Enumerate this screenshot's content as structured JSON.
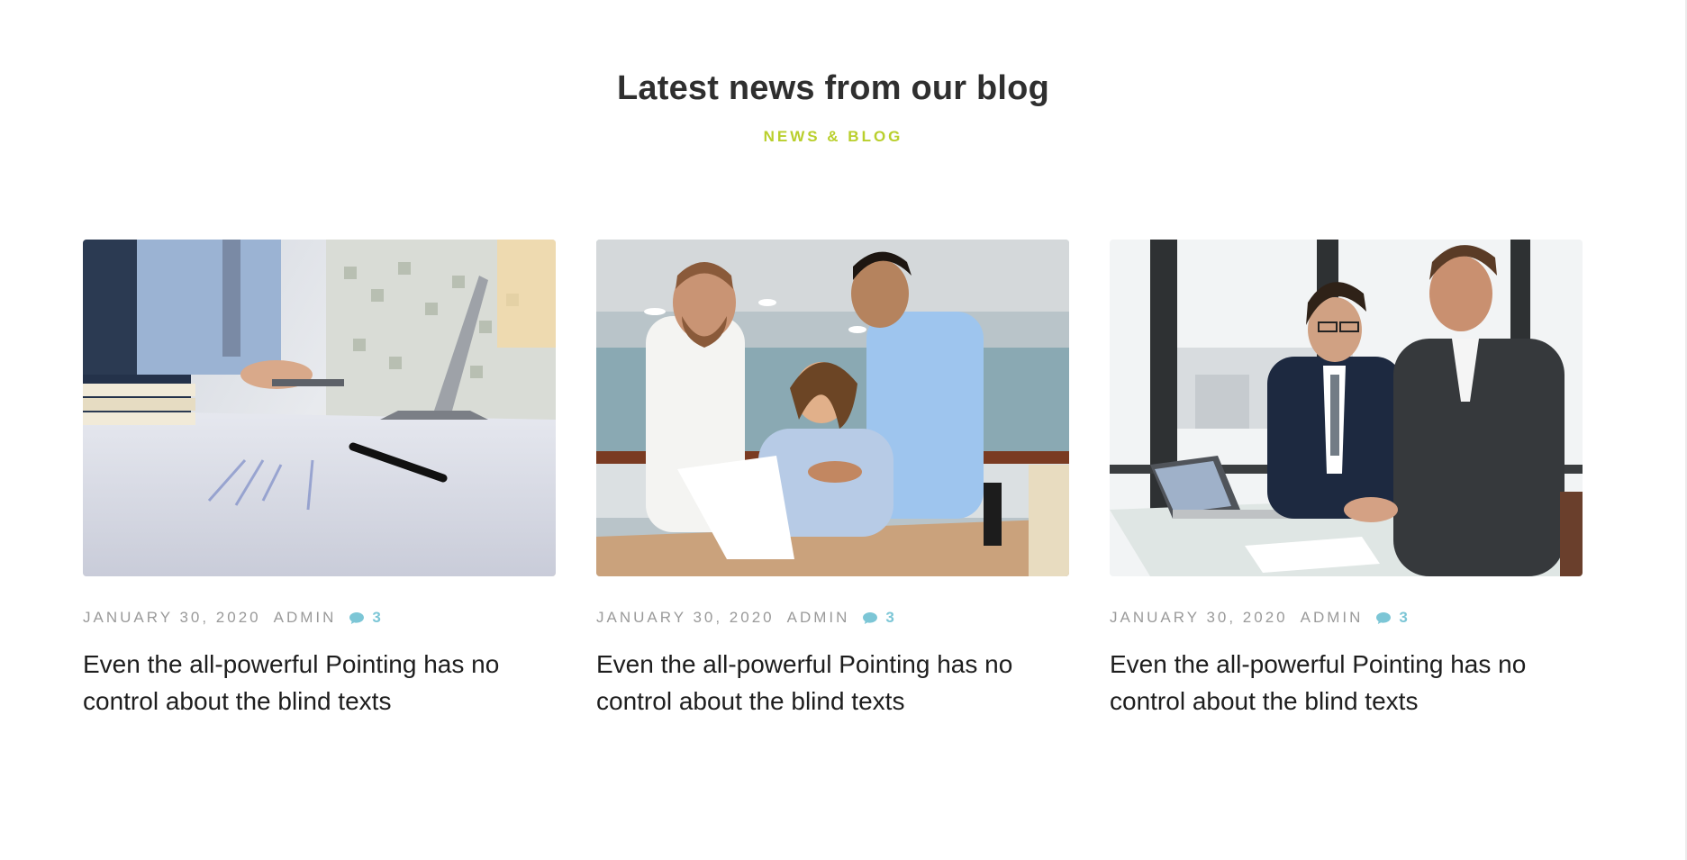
{
  "section": {
    "title": "Latest news from our blog",
    "subtitle": "NEWS & BLOG"
  },
  "posts": [
    {
      "image": "business-meeting-laptop-table-photo",
      "date": "JANUARY 30, 2020",
      "author": "ADMIN",
      "comments": "3",
      "title": "Even the all-powerful Pointing has no control about the blind texts"
    },
    {
      "image": "team-reviewing-document-photo",
      "date": "JANUARY 30, 2020",
      "author": "ADMIN",
      "comments": "3",
      "title": "Even the all-powerful Pointing has no control about the blind texts"
    },
    {
      "image": "businessmen-laptop-window-photo",
      "date": "JANUARY 30, 2020",
      "author": "ADMIN",
      "comments": "3",
      "title": "Even the all-powerful Pointing has no control about the blind texts"
    }
  ],
  "colors": {
    "accent": "#b9cf2c",
    "comment": "#7cc6d6",
    "meta": "#9a9a9a",
    "heading": "#2f2f2f"
  }
}
